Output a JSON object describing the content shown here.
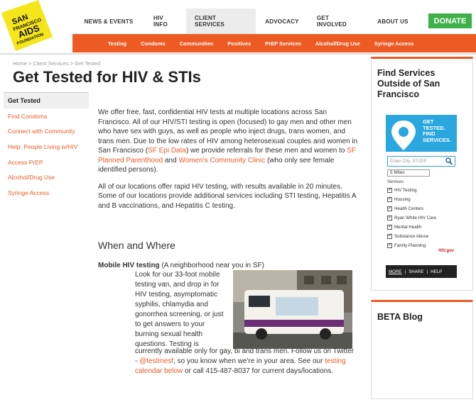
{
  "logo": {
    "lines": [
      "SAN",
      "FRANCISCO",
      "AIDS",
      "FOUNDATION"
    ],
    "color": "#f5e61b"
  },
  "topnav": {
    "items": [
      "NEWS & EVENTS",
      "HIV INFO",
      "CLIENT SERVICES",
      "ADVOCACY",
      "GET INVOLVED",
      "ABOUT US"
    ],
    "donate": "DONATE"
  },
  "subnav": {
    "items": [
      "Testing",
      "Condoms",
      "Communities",
      "Positives",
      "PrEP Services",
      "Alcohol/Drug Use",
      "Syringe Access"
    ]
  },
  "breadcrumb": "Home > Client Services > Get Tested",
  "page_title": "Get Tested for HIV & STIs",
  "leftnav": {
    "current": "Get Tested",
    "links": [
      "Find Condoms",
      "Connect with Community",
      "Help: People Living w/HIV",
      "Access PrEP",
      "Alcohol/Drug Use",
      "Syringe Access"
    ]
  },
  "intro": {
    "p1a": "We offer free, fast, confidential HIV tests at multiple locations across San Francisco. All of our HIV/STI testing is open (focused) to gay men and other men who have sex with guys, as well as people who inject drugs, trans women, and trans men. Due to the low rates of HIV among heterosexual couples and women in San Francisco (",
    "p1_link1": "SF Epi Data",
    "p1b": ") we provide referrals for these men and women to ",
    "p1_link2": "SF Planned Parenthood",
    "p1c": " and ",
    "p1_link3": "Women's Community Clinic",
    "p1d": " (who only see female identified persons).",
    "p2": "All of our locations offer rapid HIV testing, with results available in 20 minutes. Some of our locations provide additional services including STI testing, Hepatitis A and B vaccinations, and Hepatitis C testing."
  },
  "when_where": "When and Where",
  "mobile": {
    "heading": "Mobile HIV testing",
    "subheading": " (A neighborhood near you in SF)",
    "text1": "Look for our 33-foot mobile testing van, and drop in for HIV testing, asymptomatic syphilis, chlamydia and gonorrhea screening, or just to get answers to your burning sexual health questions. Testing is",
    "text2a": "currently available only for gay, bi and trans men. Follow us on Twitter - ",
    "twitter": "@testmesf",
    "text2b": ",  so you know when we're in your area. See our ",
    "calendar_link": "testing calendar below",
    "text2c": " or call 415-487-8037 for current days/locations."
  },
  "sidebar": {
    "title": "Find Services Outside of San Francisco",
    "widget": {
      "brand": [
        "GET",
        "TESTED.",
        "FIND",
        "SERVICES."
      ],
      "search_placeholder": "Enter City, ST/ZIP",
      "distance": "5 Miles",
      "services_label": "Services",
      "services": [
        "HIV Testing",
        "Housing",
        "Health Centers",
        "Ryan White HIV Care",
        "Mental Health",
        "Substance Abuse",
        "Family Planning"
      ],
      "hivgov": "HIV.gov",
      "footer": [
        "MORE",
        "|",
        "SHARE",
        "|",
        "HELP"
      ]
    }
  },
  "blog": {
    "title": "BETA Blog"
  },
  "colors": {
    "accent": "#ee5a24",
    "donate": "#3db049",
    "widget_blue": "#2aa7df"
  }
}
